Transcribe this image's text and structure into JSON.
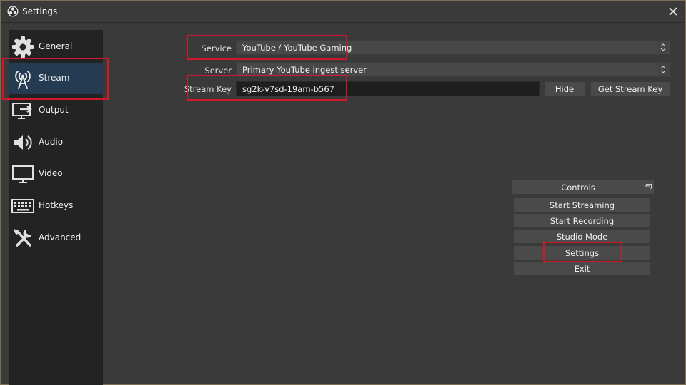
{
  "window": {
    "title": "Settings"
  },
  "sidebar": {
    "items": [
      {
        "label": "General",
        "icon": "gear-icon"
      },
      {
        "label": "Stream",
        "icon": "antenna-icon",
        "active": true
      },
      {
        "label": "Output",
        "icon": "output-icon"
      },
      {
        "label": "Audio",
        "icon": "speaker-icon"
      },
      {
        "label": "Video",
        "icon": "monitor-icon"
      },
      {
        "label": "Hotkeys",
        "icon": "keyboard-icon"
      },
      {
        "label": "Advanced",
        "icon": "tools-icon"
      }
    ]
  },
  "stream": {
    "service_label": "Service",
    "service_value": "YouTube / YouTube Gaming",
    "server_label": "Server",
    "server_value": "Primary YouTube ingest server",
    "key_label": "Stream Key",
    "key_value": "sg2k-v7sd-19am-b567",
    "hide_button": "Hide",
    "get_key_button": "Get Stream Key"
  },
  "controls": {
    "title": "Controls",
    "buttons": [
      "Start Streaming",
      "Start Recording",
      "Studio Mode",
      "Settings",
      "Exit"
    ]
  },
  "colors": {
    "highlight": "#d0182a",
    "active_nav": "#243b52",
    "background": "#3a3a3a",
    "sidebar": "#232323"
  }
}
